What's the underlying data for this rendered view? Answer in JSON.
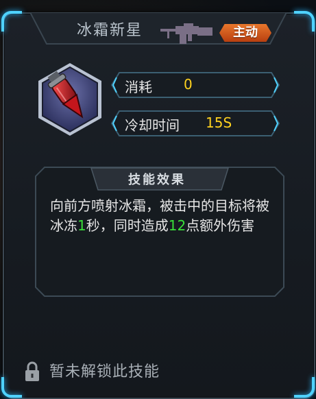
{
  "skill": {
    "name": "冰霜新星",
    "type_tag": "主动",
    "icon": "frost-rocket-icon",
    "weapon_icon": "machine-gun-icon"
  },
  "stats": [
    {
      "label": "消耗",
      "value": "0"
    },
    {
      "label": "冷却时间",
      "value": "15S"
    }
  ],
  "effect": {
    "header": "技能效果",
    "text_part1": "向前方喷射冰霜，被击中的目标将被冰冻",
    "freeze_seconds": "1",
    "text_part2": "秒，同时造成",
    "bonus_damage": "12",
    "text_part3": "点额外伤害"
  },
  "lock": {
    "icon": "lock-icon",
    "text": "暂未解锁此技能"
  },
  "colors": {
    "accent_blue": "#4fd2ff",
    "value_yellow": "#ffd21f",
    "highlight_green": "#39e039",
    "tag_orange": "#d8601e"
  }
}
